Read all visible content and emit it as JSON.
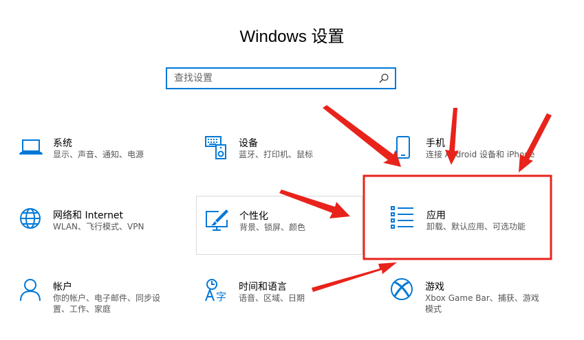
{
  "window": {
    "title": "Windows 设置"
  },
  "search": {
    "placeholder": "查找设置"
  },
  "tiles": [
    {
      "name": "系统",
      "desc": "显示、声音、通知、电源",
      "icon": "laptop-icon"
    },
    {
      "name": "设备",
      "desc": "蓝牙、打印机、鼠标",
      "icon": "keyboard-speaker-icon"
    },
    {
      "name": "手机",
      "desc": "连接 Android 设备和 iPhone",
      "icon": "phone-icon"
    },
    {
      "name": "网络和 Internet",
      "desc": "WLAN、飞行模式、VPN",
      "icon": "globe-icon"
    },
    {
      "name": "个性化",
      "desc": "背景、锁屏、颜色",
      "icon": "paint-monitor-icon"
    },
    {
      "name": "应用",
      "desc": "卸载、默认应用、可选功能",
      "icon": "apps-list-icon"
    },
    {
      "name": "帐户",
      "desc": "你的帐户、电子邮件、同步设",
      "desc2": "置、工作、家庭",
      "icon": "person-icon"
    },
    {
      "name": "时间和语言",
      "desc": "语音、区域、日期",
      "icon": "language-icon"
    },
    {
      "name": "游戏",
      "desc": "Xbox Game Bar、捕获、游戏",
      "desc2": "模式",
      "icon": "xbox-icon"
    }
  ],
  "annotation": {
    "color": "#e8231b"
  },
  "colors": {
    "accent": "#0078d7"
  }
}
